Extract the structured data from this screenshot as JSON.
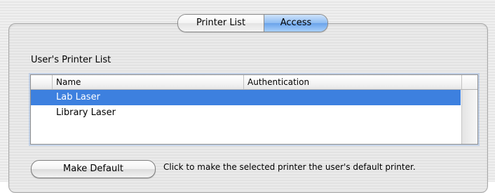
{
  "tabs": [
    {
      "label": "Printer List",
      "selected": false
    },
    {
      "label": "Access",
      "selected": true
    }
  ],
  "section_label": "User's Printer List",
  "table": {
    "columns": [
      "Name",
      "Authentication"
    ],
    "rows": [
      {
        "name": "Lab Laser",
        "authentication": "",
        "selected": true
      },
      {
        "name": "Library Laser",
        "authentication": "",
        "selected": false
      }
    ]
  },
  "make_default_button": "Make Default",
  "help_text": "Click to make the selected printer the user's default printer.",
  "colors": {
    "selection": "#3d80df",
    "selected_tab": "#8ebcf2"
  }
}
